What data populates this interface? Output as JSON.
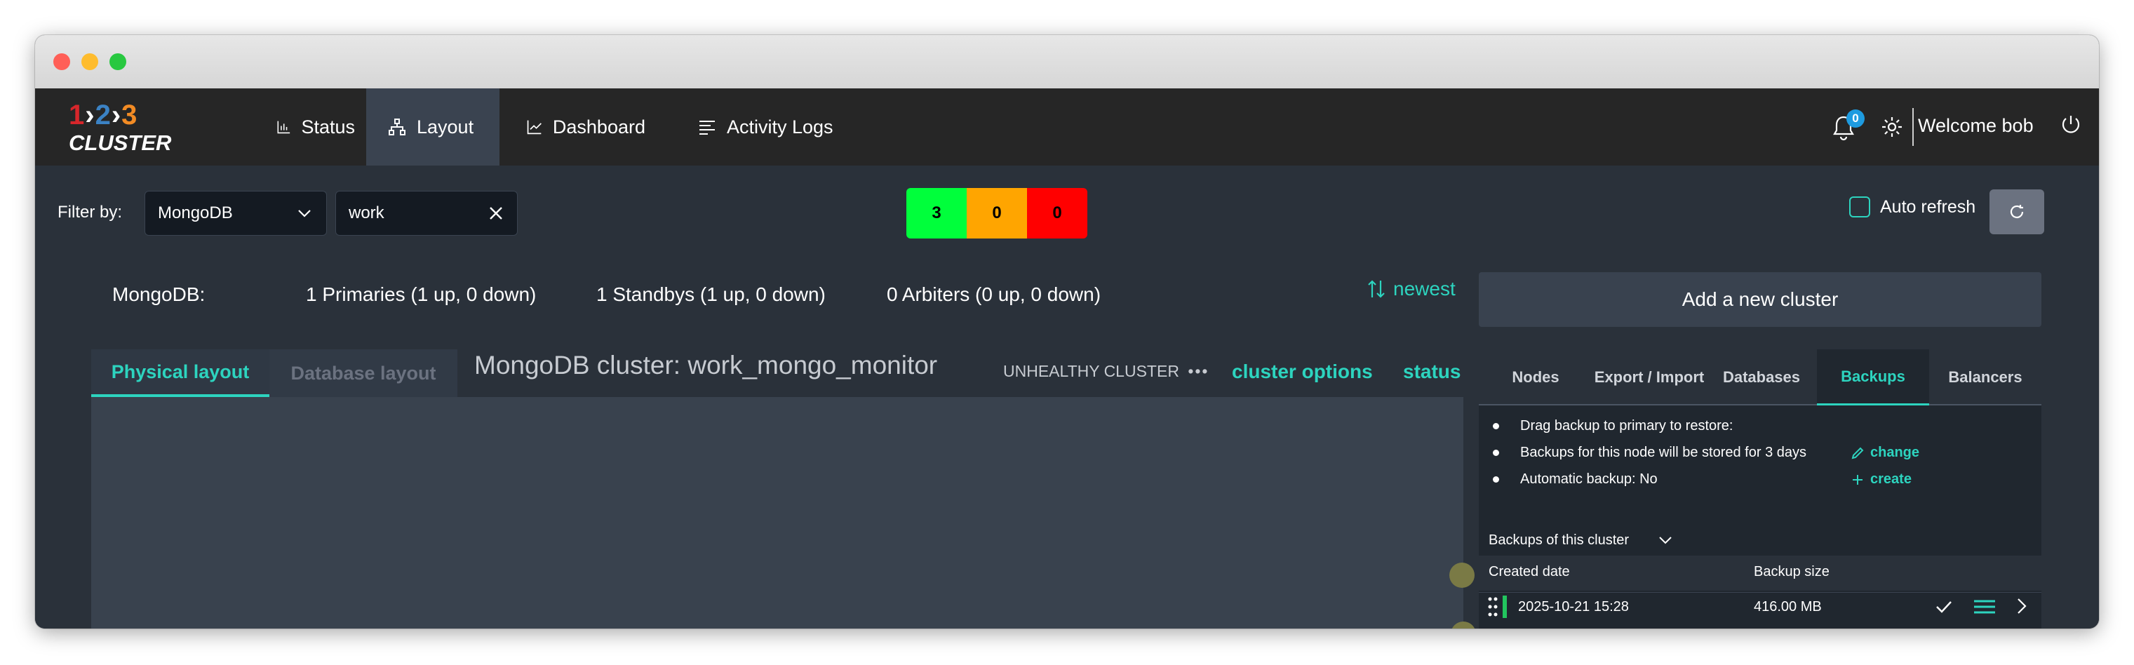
{
  "logo": {
    "digits": [
      {
        "text": "1",
        "color": "#d7262b"
      },
      {
        "text": "›",
        "color": "#ffffff"
      },
      {
        "text": "2",
        "color": "#3b82c4"
      },
      {
        "text": "›",
        "color": "#ffffff"
      },
      {
        "text": "3",
        "color": "#f28b24"
      }
    ],
    "word": "CLUSTER"
  },
  "nav": {
    "items": [
      {
        "label": "Status",
        "icon": "bar-chart-icon",
        "active": false
      },
      {
        "label": "Layout",
        "icon": "sitemap-icon",
        "active": true
      },
      {
        "label": "Dashboard",
        "icon": "line-chart-icon",
        "active": false
      },
      {
        "label": "Activity Logs",
        "icon": "list-lines-icon",
        "active": false
      }
    ]
  },
  "header": {
    "notifications_count": "0",
    "welcome": "Welcome bob",
    "icons": [
      "bell-icon",
      "gear-icon",
      "power-icon"
    ]
  },
  "filter": {
    "label": "Filter by:",
    "db_type": "MongoDB",
    "search_value": "work"
  },
  "counters": [
    {
      "value": "3",
      "color": "#00ff3b"
    },
    {
      "value": "0",
      "color": "#ffa500"
    },
    {
      "value": "0",
      "color": "#ff0000"
    }
  ],
  "auto_refresh": {
    "label": "Auto refresh",
    "checked": false
  },
  "summary": {
    "db": "MongoDB:",
    "primaries": "1 Primaries (1 up, 0 down)",
    "standbys": "1 Standbys (1 up, 0 down)",
    "arbiters": "0 Arbiters (0 up, 0 down)"
  },
  "sort_label": "newest",
  "add_cluster_label": "Add a new cluster",
  "layout_tabs": {
    "physical": "Physical layout",
    "database": "Database layout"
  },
  "cluster": {
    "title": "MongoDB cluster: work_mongo_monitor",
    "health": "UNHEALTHY CLUSTER",
    "options_label": "cluster options",
    "status_label": "status"
  },
  "side_tabs": [
    "Nodes",
    "Export / Import",
    "Databases",
    "Backups",
    "Balancers"
  ],
  "backups": {
    "info": [
      {
        "text": "Drag backup to primary to restore:"
      },
      {
        "text": "Backups for this node will be stored for 3 days",
        "action": "change"
      },
      {
        "text": "Automatic backup: No",
        "action": "create"
      }
    ],
    "list_title": "Backups of this cluster",
    "columns": [
      "Created date",
      "Backup size"
    ],
    "rows": [
      {
        "date": "2025-10-21 15:28",
        "size": "416.00 MB"
      }
    ]
  },
  "colors": {
    "accent": "#2dd4bf",
    "appbar": "#262626",
    "background": "#2a313a"
  }
}
